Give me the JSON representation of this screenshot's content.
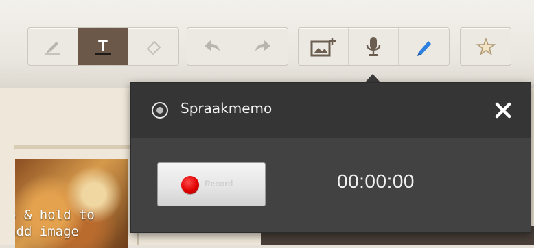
{
  "toolbar": {
    "groups": [
      {
        "name": "annotation-tools",
        "buttons": [
          {
            "icon": "highlighter-icon",
            "active": false
          },
          {
            "icon": "text-icon",
            "active": true
          },
          {
            "icon": "eraser-icon",
            "active": false
          }
        ]
      },
      {
        "name": "history-tools",
        "buttons": [
          {
            "icon": "undo-icon",
            "active": false
          },
          {
            "icon": "redo-icon",
            "active": false
          }
        ]
      },
      {
        "name": "media-tools",
        "buttons": [
          {
            "icon": "add-image-icon",
            "active": false
          },
          {
            "icon": "microphone-icon",
            "active": false
          },
          {
            "icon": "pencil-icon",
            "active": false
          }
        ]
      },
      {
        "name": "favorite-tools",
        "buttons": [
          {
            "icon": "star-icon",
            "active": false
          }
        ]
      }
    ],
    "text_tool_glyph": "T"
  },
  "background": {
    "photo_caption_line1": "p & hold to",
    "photo_caption_line2": "add image"
  },
  "memo_panel": {
    "title": "Spraakmemo",
    "record_label": "Record",
    "timer": "00:00:00",
    "close_icon": "close-icon",
    "title_icon": "record-circle-icon"
  },
  "colors": {
    "panel_bg": "#424242",
    "header_bg": "#353535",
    "record_red": "#e00000",
    "active_tool_bg": "#6b5848",
    "pencil_blue": "#2f7fe0"
  }
}
